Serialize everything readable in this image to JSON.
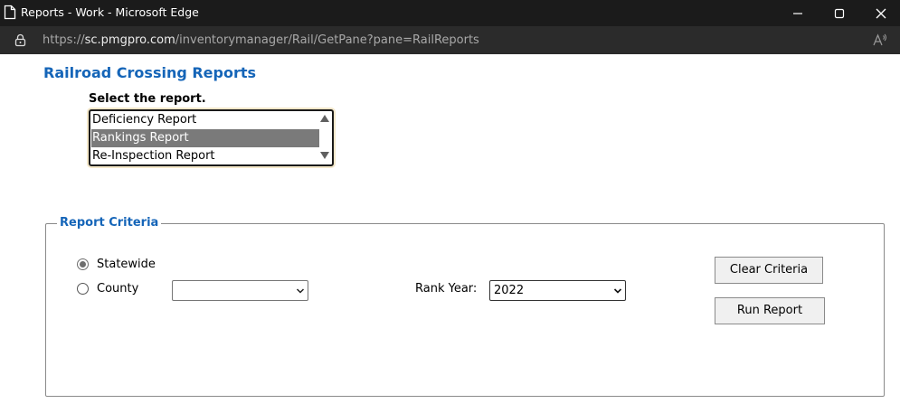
{
  "window": {
    "title": "Reports - Work - Microsoft Edge"
  },
  "address_bar": {
    "scheme": "https://",
    "host": "sc.pmgpro.com",
    "path": "/inventorymanager/Rail/GetPane?pane=RailReports"
  },
  "page": {
    "title": "Railroad Crossing Reports",
    "select_label": "Select the report.",
    "report_list": {
      "options": [
        "Deficiency Report",
        "Rankings Report",
        "Re-Inspection Report"
      ],
      "selected": "Rankings Report"
    },
    "criteria": {
      "legend": "Report Criteria",
      "scope_options": [
        {
          "label": "Statewide",
          "checked": true
        },
        {
          "label": "County",
          "checked": false
        }
      ],
      "county_value": "",
      "rank_year_label": "Rank Year:",
      "rank_year_value": "2022",
      "clear_button": "Clear Criteria",
      "run_button": "Run Report"
    }
  },
  "icons": {
    "title_page": "page-icon",
    "minimize": "minimize-icon",
    "maximize": "maximize-icon",
    "close": "close-icon",
    "lock": "lock-icon",
    "read_aloud": "read-aloud-icon",
    "dropdown": "chevron-down-icon",
    "scroll_up": "scroll-up-arrow-icon",
    "scroll_down": "scroll-down-arrow-icon"
  },
  "colors": {
    "title_blue": "#1565b8",
    "selected_option_bg": "#7a7a7a",
    "titlebar_bg": "#1b1b1b",
    "addressbar_bg": "#2b2b2b"
  }
}
